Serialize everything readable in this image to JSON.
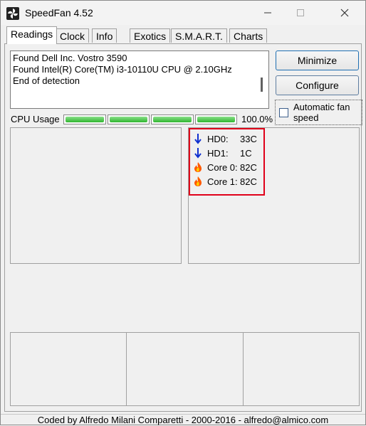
{
  "window": {
    "title": "SpeedFan 4.52"
  },
  "tabs": [
    {
      "label": "Readings"
    },
    {
      "label": "Clock"
    },
    {
      "label": "Info"
    },
    {
      "label": "Exotics"
    },
    {
      "label": "S.M.A.R.T."
    },
    {
      "label": "Charts"
    }
  ],
  "log": {
    "lines": [
      "Found Dell Inc. Vostro 3590",
      "Found Intel(R) Core(TM) i3-10110U CPU @ 2.10GHz",
      "End of detection"
    ]
  },
  "buttons": {
    "minimize": "Minimize",
    "configure": "Configure"
  },
  "auto_fan": {
    "label": "Automatic fan speed",
    "checked": false
  },
  "cpu": {
    "label": "CPU Usage",
    "percent_text": "100.0%",
    "bar_levels": [
      1.0,
      1.0,
      1.0,
      1.0
    ],
    "bar_color": "#2fb52f"
  },
  "readings": [
    {
      "name": "HD0:",
      "value": "33C",
      "icon": "arrow-down-icon"
    },
    {
      "name": "HD1:",
      "value": "1C",
      "icon": "arrow-down-icon"
    },
    {
      "name": "Core 0:",
      "value": "82C",
      "icon": "flame-icon"
    },
    {
      "name": "Core 1:",
      "value": "82C",
      "icon": "flame-icon"
    }
  ],
  "highlight_color": "#e0001a",
  "status_bar": "Coded by Alfredo Milani Comparetti - 2000-2016 - alfredo@almico.com"
}
